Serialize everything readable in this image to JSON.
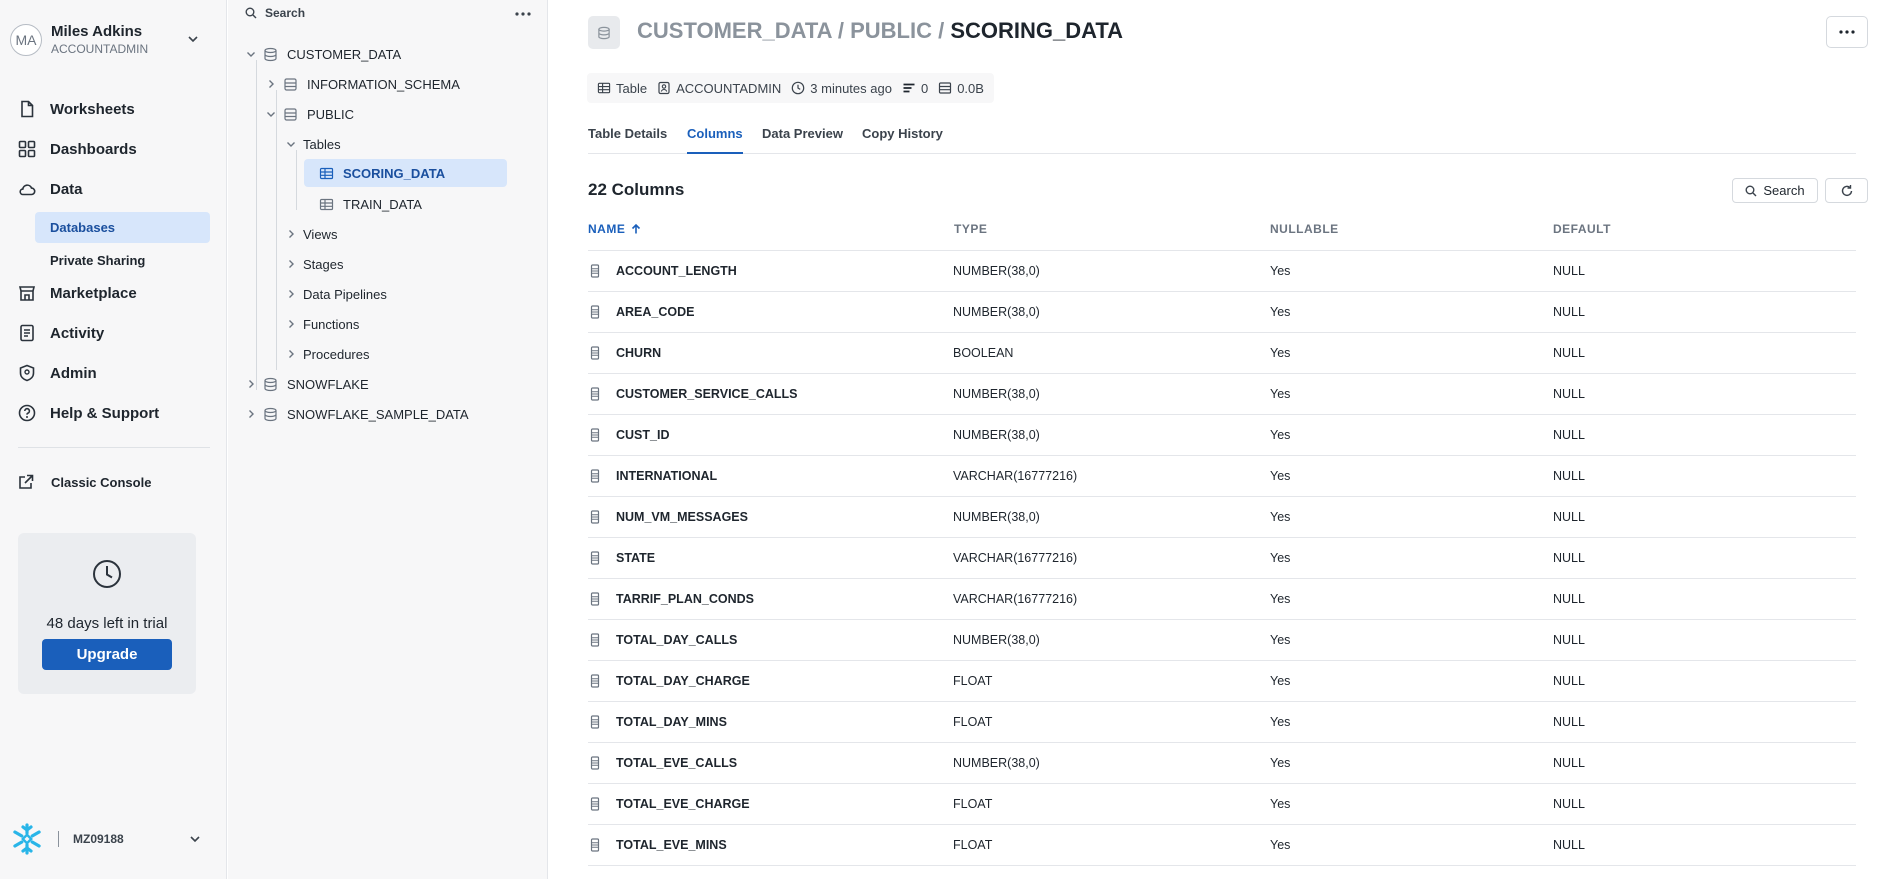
{
  "user": {
    "initials": "MA",
    "name": "Miles Adkins",
    "role": "ACCOUNTADMIN"
  },
  "nav": {
    "worksheets": "Worksheets",
    "dashboards": "Dashboards",
    "data": "Data",
    "databases": "Databases",
    "private_sharing": "Private Sharing",
    "marketplace": "Marketplace",
    "activity": "Activity",
    "admin": "Admin",
    "help": "Help & Support",
    "classic_console": "Classic Console"
  },
  "trial": {
    "text": "48 days left in trial",
    "button": "Upgrade"
  },
  "org": {
    "name": "MZ09188"
  },
  "explorer": {
    "search_label": "Search",
    "tree": {
      "customer_data": "CUSTOMER_DATA",
      "information_schema": "INFORMATION_SCHEMA",
      "public": "PUBLIC",
      "tables": "Tables",
      "scoring_data": "SCORING_DATA",
      "train_data": "TRAIN_DATA",
      "views": "Views",
      "stages": "Stages",
      "data_pipelines": "Data Pipelines",
      "functions": "Functions",
      "procedures": "Procedures",
      "snowflake": "SNOWFLAKE",
      "snowflake_sample_data": "SNOWFLAKE_SAMPLE_DATA"
    }
  },
  "header": {
    "breadcrumb_prefix": "CUSTOMER_DATA / PUBLIC / ",
    "current": "SCORING_DATA"
  },
  "meta": {
    "kind": "Table",
    "owner": "ACCOUNTADMIN",
    "updated": "3 minutes ago",
    "rows": "0",
    "size": "0.0B"
  },
  "tabs": {
    "details": "Table Details",
    "columns": "Columns",
    "preview": "Data Preview",
    "history": "Copy History"
  },
  "columns_panel": {
    "count_label": "22 Columns",
    "search_button": "Search",
    "headers": {
      "name": "NAME",
      "type": "TYPE",
      "nullable": "NULLABLE",
      "default": "DEFAULT"
    },
    "rows": [
      {
        "name": "ACCOUNT_LENGTH",
        "type": "NUMBER(38,0)",
        "nullable": "Yes",
        "default": "NULL"
      },
      {
        "name": "AREA_CODE",
        "type": "NUMBER(38,0)",
        "nullable": "Yes",
        "default": "NULL"
      },
      {
        "name": "CHURN",
        "type": "BOOLEAN",
        "nullable": "Yes",
        "default": "NULL"
      },
      {
        "name": "CUSTOMER_SERVICE_CALLS",
        "type": "NUMBER(38,0)",
        "nullable": "Yes",
        "default": "NULL"
      },
      {
        "name": "CUST_ID",
        "type": "NUMBER(38,0)",
        "nullable": "Yes",
        "default": "NULL"
      },
      {
        "name": "INTERNATIONAL",
        "type": "VARCHAR(16777216)",
        "nullable": "Yes",
        "default": "NULL"
      },
      {
        "name": "NUM_VM_MESSAGES",
        "type": "NUMBER(38,0)",
        "nullable": "Yes",
        "default": "NULL"
      },
      {
        "name": "STATE",
        "type": "VARCHAR(16777216)",
        "nullable": "Yes",
        "default": "NULL"
      },
      {
        "name": "TARRIF_PLAN_CONDS",
        "type": "VARCHAR(16777216)",
        "nullable": "Yes",
        "default": "NULL"
      },
      {
        "name": "TOTAL_DAY_CALLS",
        "type": "NUMBER(38,0)",
        "nullable": "Yes",
        "default": "NULL"
      },
      {
        "name": "TOTAL_DAY_CHARGE",
        "type": "FLOAT",
        "nullable": "Yes",
        "default": "NULL"
      },
      {
        "name": "TOTAL_DAY_MINS",
        "type": "FLOAT",
        "nullable": "Yes",
        "default": "NULL"
      },
      {
        "name": "TOTAL_EVE_CALLS",
        "type": "NUMBER(38,0)",
        "nullable": "Yes",
        "default": "NULL"
      },
      {
        "name": "TOTAL_EVE_CHARGE",
        "type": "FLOAT",
        "nullable": "Yes",
        "default": "NULL"
      },
      {
        "name": "TOTAL_EVE_MINS",
        "type": "FLOAT",
        "nullable": "Yes",
        "default": "NULL"
      }
    ]
  }
}
